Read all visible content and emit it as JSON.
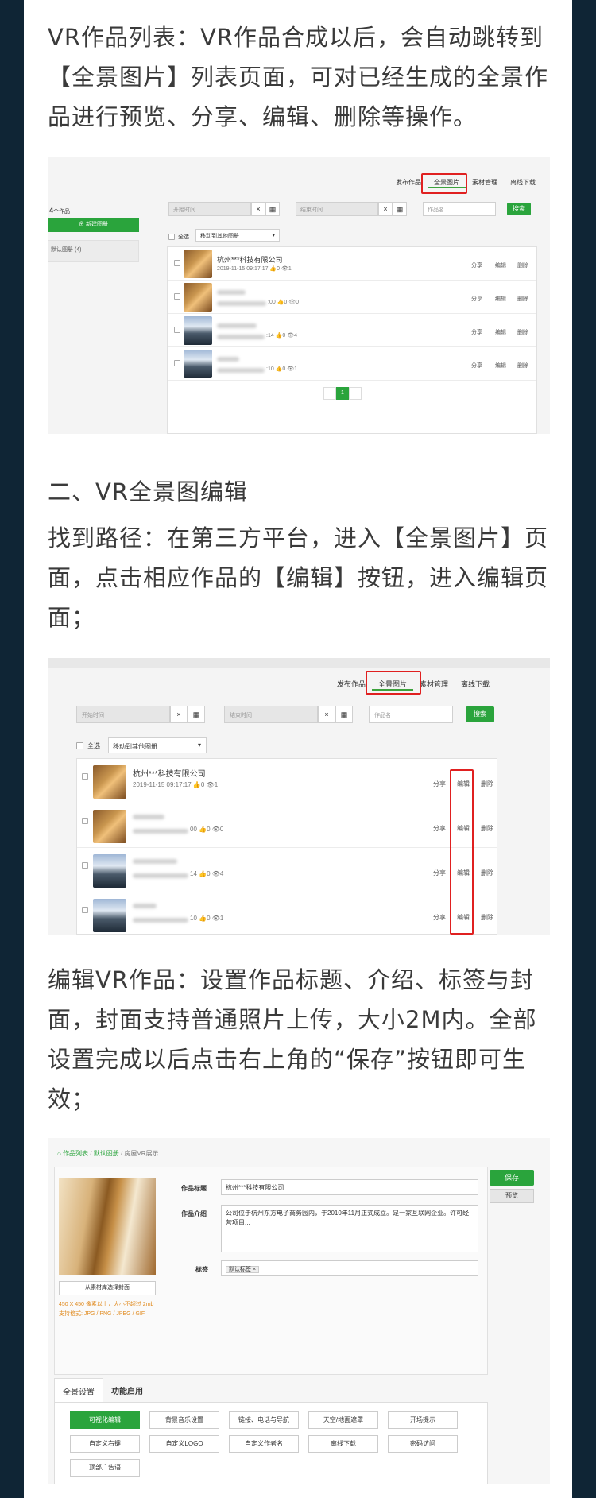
{
  "paragraphs": {
    "p1": [
      "VR作品列表：VR作品合成以后，会自动跳转到",
      "【全景图片】列表页面，可对已经生成的全景作",
      "品进行预览、分享、编辑、删除等操作。"
    ],
    "heading2": "二、VR全景图编辑",
    "p2": [
      "找到路径：在第三方平台，进入【全景图片】页",
      "面，点击相应作品的【编辑】按钮，进入编辑页",
      "面；"
    ],
    "p3": [
      "编辑VR作品：设置作品标题、介绍、标签与封",
      "面，封面支持普通照片上传，大小2M内。全部",
      "设置完成以后点击右上角的“保存”按钮即可生",
      "效；"
    ]
  },
  "shot1": {
    "tabs": [
      "发布作品",
      "全景图片",
      "素材管理",
      "离线下载"
    ],
    "count_num": "4",
    "count_label": "个作品",
    "new_album": "新建图册",
    "album_item": "默认图册 (4)",
    "start_placeholder": "开始时间",
    "end_placeholder": "结束时间",
    "name_placeholder": "作品名",
    "clear": "×",
    "cal": "▦",
    "search": "搜索",
    "select_all": "全选",
    "move_to": "移动到其他图册",
    "row1_title": "杭州***科技有限公司",
    "row1_meta": "2019-11-15 09:17:17  👍0  👁1",
    "row2_meta": ":00  👍0  👁0",
    "row3_meta": ":14  👍0  👁4",
    "row4_meta": ":10  👍0  👁1",
    "share": "分享",
    "edit": "编辑",
    "del": "删除",
    "page": "1"
  },
  "shot2": {
    "tabs": [
      "发布作品",
      "全景图片",
      "素材管理",
      "离线下载"
    ],
    "start_placeholder": "开始时间",
    "end_placeholder": "结束时间",
    "name_placeholder": "作品名",
    "clear": "×",
    "cal": "▦",
    "search": "搜索",
    "select_all": "全选",
    "move_to": "移动到其他图册",
    "row1_title": "杭州***科技有限公司",
    "row1_meta": "2019-11-15 09:17:17  👍0  👁1",
    "row2_meta": "00  👍0  👁0",
    "row3_meta": "14  👍0  👁4",
    "row4_meta": "10  👍0  👁1",
    "share": "分享",
    "edit": "编辑",
    "del": "删除"
  },
  "shot3": {
    "breadcrumb": [
      "作品列表",
      "默认图册",
      "房屋VR展示"
    ],
    "title_label": "作品标题",
    "title_value": "杭州***科技有限公司",
    "intro_label": "作品介绍",
    "intro_value": "公司位于杭州东方电子商务园内，于2010年11月正式成立。是一家互联网企业。许可经营项目...",
    "tag_label": "标签",
    "tag_value": "默认标签 ×",
    "save": "保存",
    "preview": "预览",
    "choose_cover": "从素材库选择封面",
    "cover_hint": "450 X 450 像素以上，大小不超过 2mb 支持格式: JPG / PNG / JPEG / GIF",
    "tab_global": "全景设置",
    "tab_func": "功能启用",
    "grid": [
      "可视化编辑",
      "背景音乐设置",
      "链接、电话与导航",
      "天空/地面遮罩",
      "开场提示",
      "自定义右键",
      "自定义LOGO",
      "自定义作者名",
      "离线下载",
      "密码访问",
      "顶部广告语"
    ]
  }
}
